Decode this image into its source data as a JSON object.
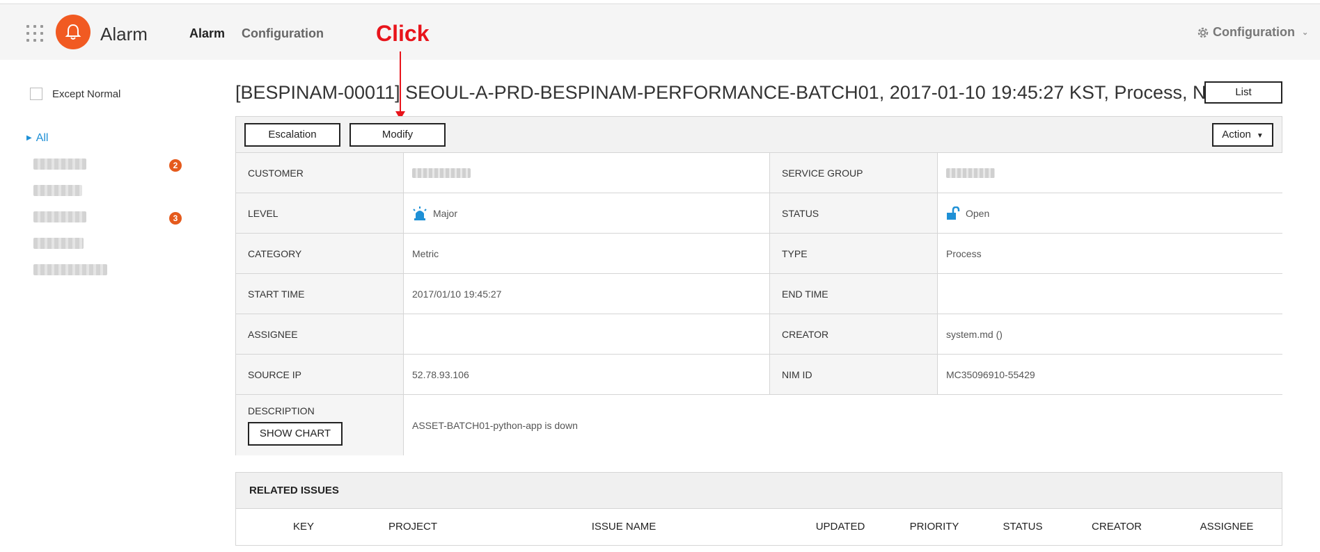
{
  "header": {
    "app_name": "Alarm",
    "nav": [
      "Alarm",
      "Configuration"
    ],
    "top_config": "Configuration"
  },
  "annotation": {
    "label": "Click"
  },
  "sidebar": {
    "except_normal": "Except Normal",
    "all": "All",
    "badges": [
      "2",
      "3"
    ]
  },
  "main": {
    "title": "[BESPINAM-00011] SEOUL-A-PRD-BESPINAM-PERFORMANCE-BATCH01, 2017-01-10 19:45:27 KST, Process, NO",
    "list_btn": "List",
    "toolbar": {
      "escalation": "Escalation",
      "modify": "Modify",
      "action": "Action"
    },
    "fields": {
      "customer_label": "CUSTOMER",
      "service_group_label": "SERVICE GROUP",
      "level_label": "LEVEL",
      "level_value": "Major",
      "status_label": "STATUS",
      "status_value": "Open",
      "category_label": "CATEGORY",
      "category_value": "Metric",
      "type_label": "TYPE",
      "type_value": "Process",
      "start_time_label": "START TIME",
      "start_time_value": "2017/01/10 19:45:27",
      "end_time_label": "END TIME",
      "end_time_value": "",
      "assignee_label": "ASSIGNEE",
      "assignee_value": "",
      "creator_label": "CREATOR",
      "creator_value": "system.md ()",
      "source_ip_label": "SOURCE IP",
      "source_ip_value": "52.78.93.106",
      "nim_id_label": "NIM ID",
      "nim_id_value": "MC35096910-55429",
      "description_label": "DESCRIPTION",
      "show_chart": "SHOW CHART",
      "description_value": "ASSET-BATCH01-python-app is down"
    },
    "related": {
      "title": "RELATED ISSUES",
      "columns": [
        "KEY",
        "PROJECT",
        "ISSUE NAME",
        "UPDATED",
        "PRIORITY",
        "STATUS",
        "CREATOR",
        "ASSIGNEE"
      ]
    }
  },
  "colors": {
    "brand": "#f15a22",
    "accent": "#1e90d6",
    "annotation": "#e8141b"
  }
}
